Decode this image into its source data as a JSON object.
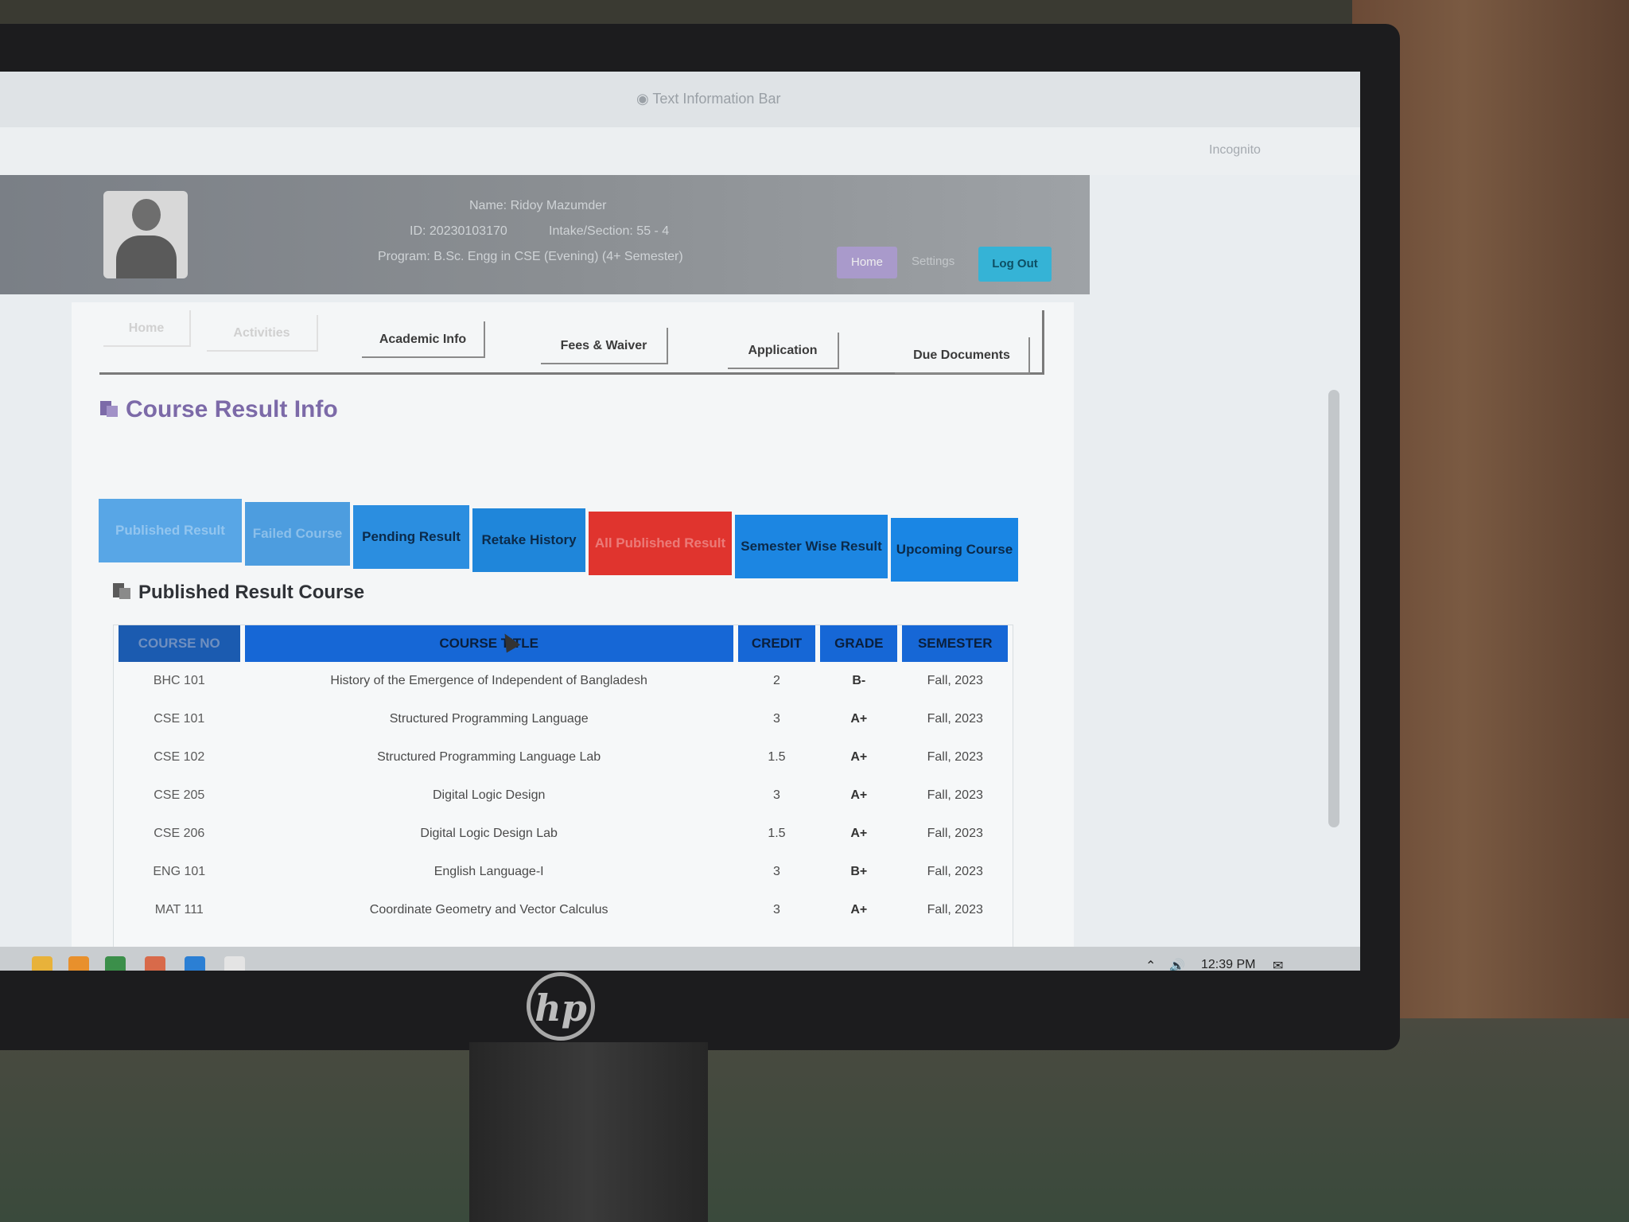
{
  "browser": {
    "tab_title": "Text Information Bar",
    "address_right": "Incognito"
  },
  "header": {
    "name_line": "Name: Ridoy Mazumder",
    "id_line": "ID: 20230103170",
    "intake_line": "Intake/Section: 55 - 4",
    "program_line": "Program: B.Sc. Engg in CSE (Evening) (4+ Semester)",
    "home_label": "Home",
    "settings_label": "Settings",
    "logout_label": "Log Out"
  },
  "topnav": {
    "tabs": [
      "Home",
      "Activities",
      "Academic Info",
      "Fees & Waiver",
      "Application",
      "Due Documents"
    ]
  },
  "page_title": "Course Result Info",
  "subtabs": {
    "items": [
      {
        "label": "Published Result",
        "bg": "#58a6e6",
        "faded": true
      },
      {
        "label": "Failed Course",
        "bg": "#4d9ddf",
        "faded": true
      },
      {
        "label": "Pending Result",
        "bg": "#2b8ee0",
        "faded": false
      },
      {
        "label": "Retake History",
        "bg": "#1f86da",
        "faded": false
      },
      {
        "label": "All Published Result",
        "bg": "#e0342e",
        "faded": true
      },
      {
        "label": "Semester Wise Result",
        "bg": "#1c86e2",
        "faded": false
      },
      {
        "label": "Upcoming Course",
        "bg": "#1a86e4",
        "faded": false
      }
    ]
  },
  "section_title": "Published Result Course",
  "table": {
    "headers": [
      "COURSE NO",
      "COURSE TITLE",
      "CREDIT",
      "GRADE",
      "SEMESTER"
    ],
    "rows": [
      [
        "BHC 101",
        "History of the Emergence of Independent of Bangladesh",
        "2",
        "B-",
        "Fall, 2023"
      ],
      [
        "CSE 101",
        "Structured Programming Language",
        "3",
        "A+",
        "Fall, 2023"
      ],
      [
        "CSE 102",
        "Structured Programming Language Lab",
        "1.5",
        "A+",
        "Fall, 2023"
      ],
      [
        "CSE 205",
        "Digital Logic Design",
        "3",
        "A+",
        "Fall, 2023"
      ],
      [
        "CSE 206",
        "Digital Logic Design Lab",
        "1.5",
        "A+",
        "Fall, 2023"
      ],
      [
        "ENG 101",
        "English Language-I",
        "3",
        "B+",
        "Fall, 2023"
      ],
      [
        "MAT 111",
        "Coordinate Geometry and Vector Calculus",
        "3",
        "A+",
        "Fall, 2023"
      ]
    ]
  },
  "taskbar": {
    "time": "12:39 PM"
  },
  "monitor": {
    "brand": "hp"
  }
}
